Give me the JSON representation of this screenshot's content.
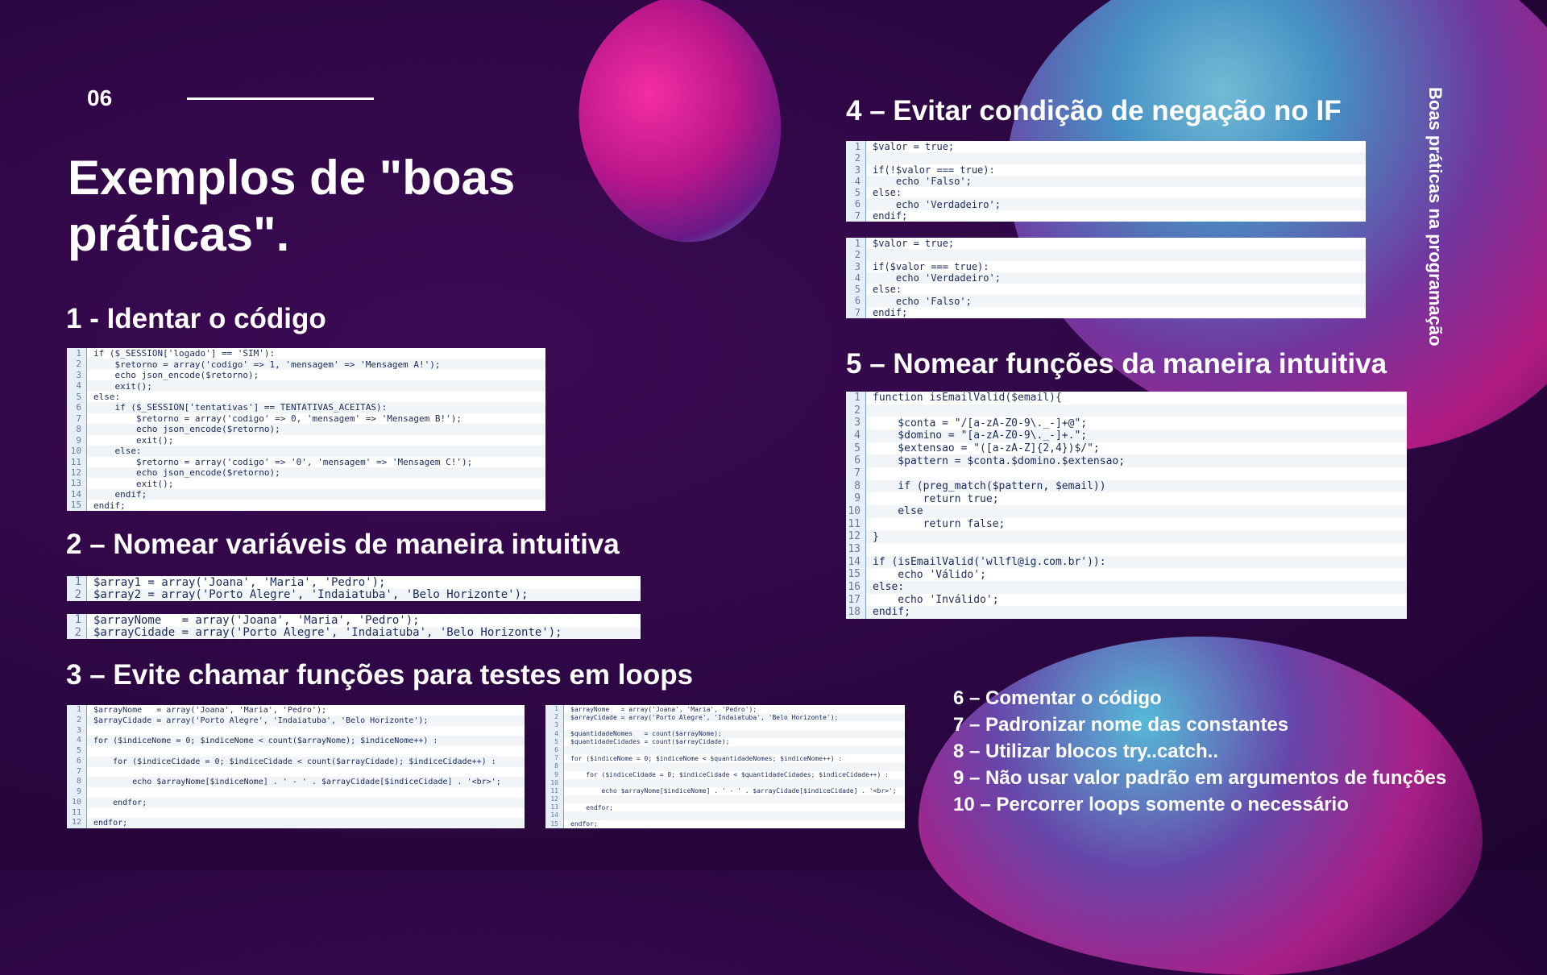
{
  "slide": {
    "number": "06",
    "title": "Exemplos de \"boas práticas\".",
    "side_title": "Boas práticas na programação"
  },
  "sections": {
    "s1": "1 - Identar o código",
    "s2": "2 – Nomear variáveis de maneira intuitiva",
    "s3": "3 – Evite chamar funções para testes em loops",
    "s4": "4 – Evitar condição de negação no IF",
    "s5": "5 – Nomear funções da maneira intuitiva"
  },
  "list_items": [
    "6 – Comentar o código",
    "7 – Padronizar nome das constantes",
    "8 – Utilizar blocos try..catch..",
    "9 – Não usar valor padrão em argumentos de funções",
    "10 – Percorrer loops somente o necessário"
  ],
  "code_blocks": {
    "c1": [
      "if ($_SESSION['logado'] == 'SIM'):",
      "    $retorno = array('codigo' => 1, 'mensagem' => 'Mensagem A!');",
      "    echo json_encode($retorno);",
      "    exit();",
      "else:",
      "    if ($_SESSION['tentativas'] == TENTATIVAS_ACEITAS):",
      "        $retorno = array('codigo' => 0, 'mensagem' => 'Mensagem B!');",
      "        echo json_encode($retorno);",
      "        exit();",
      "    else:",
      "        $retorno = array('codigo' => '0', 'mensagem' => 'Mensagem C!');",
      "        echo json_encode($retorno);",
      "        exit();",
      "    endif;",
      "endif;"
    ],
    "c2a": [
      "$array1 = array('Joana', 'Maria', 'Pedro');",
      "$array2 = array('Porto Alegre', 'Indaiatuba', 'Belo Horizonte');"
    ],
    "c2b": [
      "$arrayNome   = array('Joana', 'Maria', 'Pedro');",
      "$arrayCidade = array('Porto Alegre', 'Indaiatuba', 'Belo Horizonte');"
    ],
    "c3a": [
      "$arrayNome   = array('Joana', 'Maria', 'Pedro');",
      "$arrayCidade = array('Porto Alegre', 'Indaiatuba', 'Belo Horizonte');",
      "",
      "for ($indiceNome = 0; $indiceNome < count($arrayNome); $indiceNome++) :",
      "",
      "    for ($indiceCidade = 0; $indiceCidade < count($arrayCidade); $indiceCidade++) :",
      "",
      "        echo $arrayNome[$indiceNome] . ' - ' . $arrayCidade[$indiceCidade] . '<br>';",
      "",
      "    endfor;",
      "",
      "endfor;"
    ],
    "c3b": [
      "$arrayNome   = array('Joana', 'Maria', 'Pedro');",
      "$arrayCidade = array('Porto Alegre', 'Indaiatuba', 'Belo Horizonte');",
      "",
      "$quantidadeNomes   = count($arrayNome);",
      "$quantidadeCidades = count($arrayCidade);",
      "",
      "for ($indiceNome = 0; $indiceNome < $quantidadeNomes; $indiceNome++) :",
      "",
      "    for ($indiceCidade = 0; $indiceCidade < $quantidadeCidades; $indiceCidade++) :",
      "",
      "        echo $arrayNome[$indiceNome] . ' - ' . $arrayCidade[$indiceCidade] . '<br>';",
      "",
      "    endfor;",
      "",
      "endfor;"
    ],
    "c4a": [
      "$valor = true;",
      "",
      "if(!$valor === true):",
      "    echo 'Falso';",
      "else:",
      "    echo 'Verdadeiro';",
      "endif;"
    ],
    "c4b": [
      "$valor = true;",
      "",
      "if($valor === true):",
      "    echo 'Verdadeiro';",
      "else:",
      "    echo 'Falso';",
      "endif;"
    ],
    "c5": [
      "function isEmailValid($email){",
      "",
      "    $conta = \"/[a-zA-Z0-9\\._-]+@\";",
      "    $domino = \"[a-zA-Z0-9\\._-]+.\";",
      "    $extensao = \"([a-zA-Z]{2,4})$/\";",
      "    $pattern = $conta.$domino.$extensao;",
      "",
      "    if (preg_match($pattern, $email))",
      "        return true;",
      "    else",
      "        return false;",
      "}",
      "",
      "if (isEmailValid('wllfl@ig.com.br')):",
      "    echo 'Válido';",
      "else:",
      "    echo 'Inválido';",
      "endif;"
    ]
  }
}
